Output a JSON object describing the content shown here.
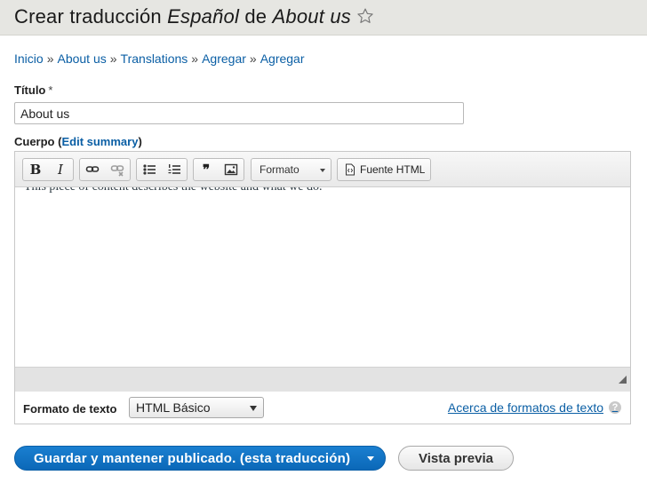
{
  "header": {
    "title_prefix": "Crear traducción",
    "language": "Español",
    "title_middle": "de",
    "node_title": "About us"
  },
  "breadcrumb": {
    "items": [
      "Inicio",
      "About us",
      "Translations",
      "Agregar",
      "Agregar"
    ],
    "separator": "»"
  },
  "title_field": {
    "label": "Título",
    "required_mark": "*",
    "value": "About us"
  },
  "body_field": {
    "label": "Cuerpo",
    "summary_link": "Edit summary",
    "paren_open": "(",
    "paren_close": ")"
  },
  "toolbar": {
    "bold": "B",
    "italic": "I",
    "blockquote": "❞",
    "format_label": "Formato",
    "source_label": "Fuente HTML",
    "icons": [
      "bold-icon",
      "italic-icon",
      "link-icon",
      "unlink-icon",
      "bulleted-list-icon",
      "numbered-list-icon",
      "blockquote-icon",
      "image-icon"
    ]
  },
  "editor": {
    "content": "This piece of content describes the website and what we do."
  },
  "text_format": {
    "label": "Formato de texto",
    "selected": "HTML Básico",
    "help_link": "Acerca de formatos de texto",
    "help_icon": "?"
  },
  "actions": {
    "save_label": "Guardar y mantener publicado. (esta traducción)",
    "preview_label": "Vista previa"
  },
  "colors": {
    "link": "#0b5fa5",
    "primary_button": "#0b68b8",
    "header_bg": "#e6e6e2"
  }
}
